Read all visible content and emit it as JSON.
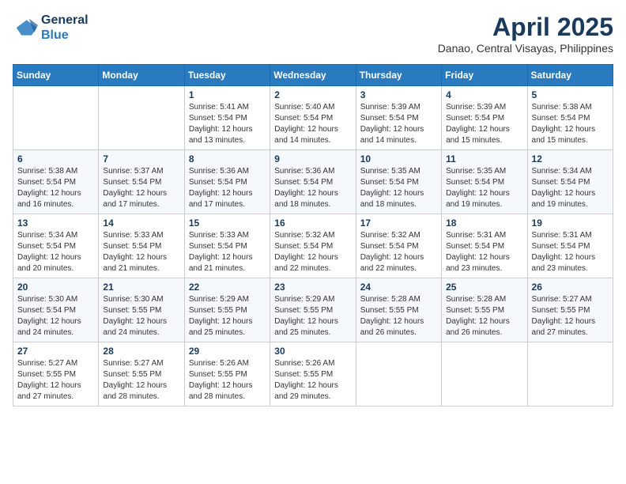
{
  "header": {
    "logo_line1": "General",
    "logo_line2": "Blue",
    "month": "April 2025",
    "location": "Danao, Central Visayas, Philippines"
  },
  "weekdays": [
    "Sunday",
    "Monday",
    "Tuesday",
    "Wednesday",
    "Thursday",
    "Friday",
    "Saturday"
  ],
  "weeks": [
    [
      {
        "day": "",
        "info": ""
      },
      {
        "day": "",
        "info": ""
      },
      {
        "day": "1",
        "info": "Sunrise: 5:41 AM\nSunset: 5:54 PM\nDaylight: 12 hours\nand 13 minutes."
      },
      {
        "day": "2",
        "info": "Sunrise: 5:40 AM\nSunset: 5:54 PM\nDaylight: 12 hours\nand 14 minutes."
      },
      {
        "day": "3",
        "info": "Sunrise: 5:39 AM\nSunset: 5:54 PM\nDaylight: 12 hours\nand 14 minutes."
      },
      {
        "day": "4",
        "info": "Sunrise: 5:39 AM\nSunset: 5:54 PM\nDaylight: 12 hours\nand 15 minutes."
      },
      {
        "day": "5",
        "info": "Sunrise: 5:38 AM\nSunset: 5:54 PM\nDaylight: 12 hours\nand 15 minutes."
      }
    ],
    [
      {
        "day": "6",
        "info": "Sunrise: 5:38 AM\nSunset: 5:54 PM\nDaylight: 12 hours\nand 16 minutes."
      },
      {
        "day": "7",
        "info": "Sunrise: 5:37 AM\nSunset: 5:54 PM\nDaylight: 12 hours\nand 17 minutes."
      },
      {
        "day": "8",
        "info": "Sunrise: 5:36 AM\nSunset: 5:54 PM\nDaylight: 12 hours\nand 17 minutes."
      },
      {
        "day": "9",
        "info": "Sunrise: 5:36 AM\nSunset: 5:54 PM\nDaylight: 12 hours\nand 18 minutes."
      },
      {
        "day": "10",
        "info": "Sunrise: 5:35 AM\nSunset: 5:54 PM\nDaylight: 12 hours\nand 18 minutes."
      },
      {
        "day": "11",
        "info": "Sunrise: 5:35 AM\nSunset: 5:54 PM\nDaylight: 12 hours\nand 19 minutes."
      },
      {
        "day": "12",
        "info": "Sunrise: 5:34 AM\nSunset: 5:54 PM\nDaylight: 12 hours\nand 19 minutes."
      }
    ],
    [
      {
        "day": "13",
        "info": "Sunrise: 5:34 AM\nSunset: 5:54 PM\nDaylight: 12 hours\nand 20 minutes."
      },
      {
        "day": "14",
        "info": "Sunrise: 5:33 AM\nSunset: 5:54 PM\nDaylight: 12 hours\nand 21 minutes."
      },
      {
        "day": "15",
        "info": "Sunrise: 5:33 AM\nSunset: 5:54 PM\nDaylight: 12 hours\nand 21 minutes."
      },
      {
        "day": "16",
        "info": "Sunrise: 5:32 AM\nSunset: 5:54 PM\nDaylight: 12 hours\nand 22 minutes."
      },
      {
        "day": "17",
        "info": "Sunrise: 5:32 AM\nSunset: 5:54 PM\nDaylight: 12 hours\nand 22 minutes."
      },
      {
        "day": "18",
        "info": "Sunrise: 5:31 AM\nSunset: 5:54 PM\nDaylight: 12 hours\nand 23 minutes."
      },
      {
        "day": "19",
        "info": "Sunrise: 5:31 AM\nSunset: 5:54 PM\nDaylight: 12 hours\nand 23 minutes."
      }
    ],
    [
      {
        "day": "20",
        "info": "Sunrise: 5:30 AM\nSunset: 5:54 PM\nDaylight: 12 hours\nand 24 minutes."
      },
      {
        "day": "21",
        "info": "Sunrise: 5:30 AM\nSunset: 5:55 PM\nDaylight: 12 hours\nand 24 minutes."
      },
      {
        "day": "22",
        "info": "Sunrise: 5:29 AM\nSunset: 5:55 PM\nDaylight: 12 hours\nand 25 minutes."
      },
      {
        "day": "23",
        "info": "Sunrise: 5:29 AM\nSunset: 5:55 PM\nDaylight: 12 hours\nand 25 minutes."
      },
      {
        "day": "24",
        "info": "Sunrise: 5:28 AM\nSunset: 5:55 PM\nDaylight: 12 hours\nand 26 minutes."
      },
      {
        "day": "25",
        "info": "Sunrise: 5:28 AM\nSunset: 5:55 PM\nDaylight: 12 hours\nand 26 minutes."
      },
      {
        "day": "26",
        "info": "Sunrise: 5:27 AM\nSunset: 5:55 PM\nDaylight: 12 hours\nand 27 minutes."
      }
    ],
    [
      {
        "day": "27",
        "info": "Sunrise: 5:27 AM\nSunset: 5:55 PM\nDaylight: 12 hours\nand 27 minutes."
      },
      {
        "day": "28",
        "info": "Sunrise: 5:27 AM\nSunset: 5:55 PM\nDaylight: 12 hours\nand 28 minutes."
      },
      {
        "day": "29",
        "info": "Sunrise: 5:26 AM\nSunset: 5:55 PM\nDaylight: 12 hours\nand 28 minutes."
      },
      {
        "day": "30",
        "info": "Sunrise: 5:26 AM\nSunset: 5:55 PM\nDaylight: 12 hours\nand 29 minutes."
      },
      {
        "day": "",
        "info": ""
      },
      {
        "day": "",
        "info": ""
      },
      {
        "day": "",
        "info": ""
      }
    ]
  ]
}
